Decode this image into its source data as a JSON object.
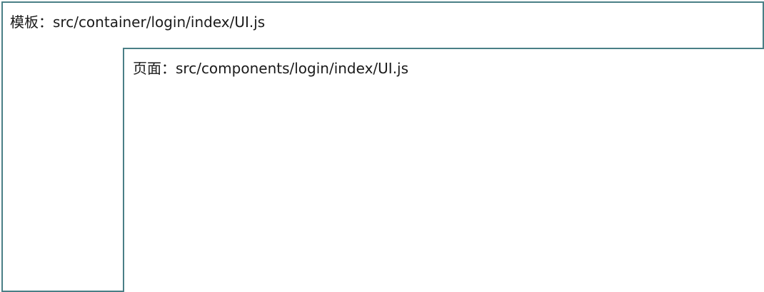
{
  "template_box": {
    "label_prefix": "模板：",
    "label_path": "src/container/login/index/UI.js"
  },
  "page_box": {
    "label_prefix": "页面：",
    "label_path": "src/components/login/index/UI.js"
  }
}
